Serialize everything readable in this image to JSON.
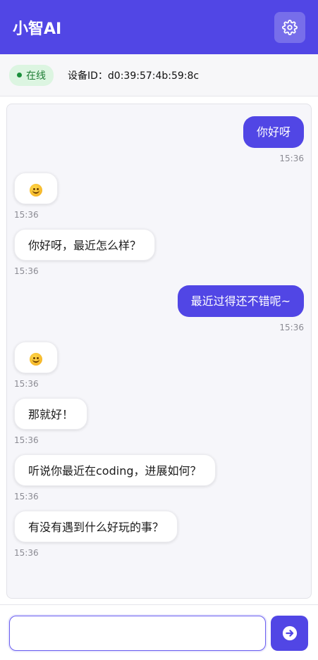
{
  "header": {
    "title": "小智AI",
    "settings_icon": "gear-icon"
  },
  "status": {
    "online_label": "在线",
    "device_label": "设备ID：d0:39:57:4b:59:8c"
  },
  "colors": {
    "accent": "#5146e5",
    "online": "#1a8f3a"
  },
  "messages": [
    {
      "role": "user",
      "text": "你好呀",
      "time": "15:36"
    },
    {
      "role": "bot",
      "emoji": "smiling-face-icon",
      "time": "15:36"
    },
    {
      "role": "bot",
      "text": "你好呀，最近怎么样？",
      "time": "15:36"
    },
    {
      "role": "user",
      "text": "最近过得还不错呢~",
      "time": "15:36"
    },
    {
      "role": "bot",
      "emoji": "smiling-face-icon",
      "time": "15:36"
    },
    {
      "role": "bot",
      "text": "那就好！",
      "time": "15:36"
    },
    {
      "role": "bot",
      "text": "听说你最近在coding，进展如何？",
      "time": "15:36"
    },
    {
      "role": "bot",
      "text": "有没有遇到什么好玩的事？",
      "time": "15:36"
    }
  ],
  "input": {
    "value": "",
    "placeholder": ""
  },
  "send_icon": "send-arrow-icon"
}
